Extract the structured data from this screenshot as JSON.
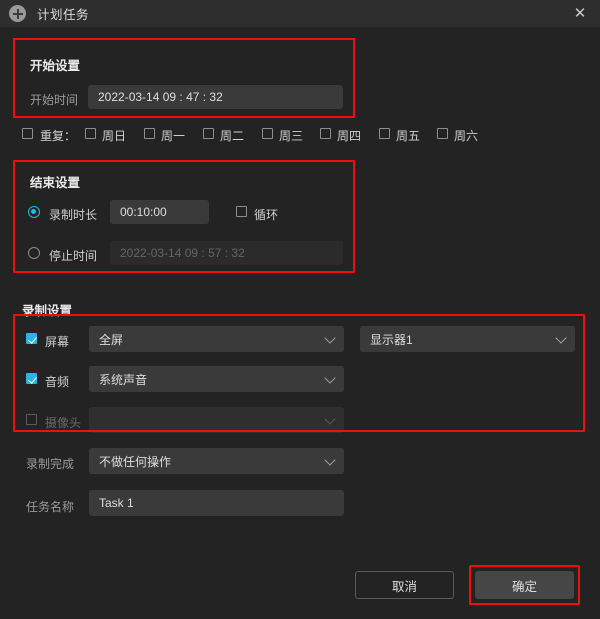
{
  "window": {
    "title": "计划任务",
    "icon": "plus-circle-icon",
    "close_label": "✕"
  },
  "start_settings": {
    "title": "开始设置",
    "start_time_label": "开始时间",
    "start_time_value": "2022-03-14 09 : 47 : 32"
  },
  "repeat": {
    "label": "重复：",
    "checked": false,
    "days": [
      {
        "label": "周日",
        "checked": false
      },
      {
        "label": "周一",
        "checked": false
      },
      {
        "label": "周二",
        "checked": false
      },
      {
        "label": "周三",
        "checked": false
      },
      {
        "label": "周四",
        "checked": false
      },
      {
        "label": "周五",
        "checked": false
      },
      {
        "label": "周六",
        "checked": false
      }
    ]
  },
  "end_settings": {
    "title": "结束设置",
    "duration_label": "录制时长",
    "duration_value": "00:10:00",
    "duration_selected": true,
    "loop_label": "循环",
    "loop_checked": false,
    "stop_time_label": "停止时间",
    "stop_time_value": "2022-03-14 09 : 57 : 32",
    "stop_time_selected": false
  },
  "record_settings": {
    "title": "录制设置",
    "screen_label": "屏幕",
    "screen_checked": true,
    "screen_value": "全屏",
    "monitor_value": "显示器1",
    "audio_label": "音频",
    "audio_checked": true,
    "audio_value": "系统声音",
    "camera_label": "摄像头",
    "camera_checked": false,
    "camera_value": ""
  },
  "after_record": {
    "label": "录制完成",
    "value": "不做任何操作"
  },
  "task_name": {
    "label": "任务名称",
    "value": "Task 1"
  },
  "buttons": {
    "cancel": "取消",
    "confirm": "确定"
  },
  "colors": {
    "accent_cyan": "#17c0e0",
    "checkbox_blue": "#2bb3e3",
    "annotation_red": "#f10e0e",
    "background": "#232323",
    "titlebar": "#2e2e2e",
    "field": "#3a3a3a"
  }
}
